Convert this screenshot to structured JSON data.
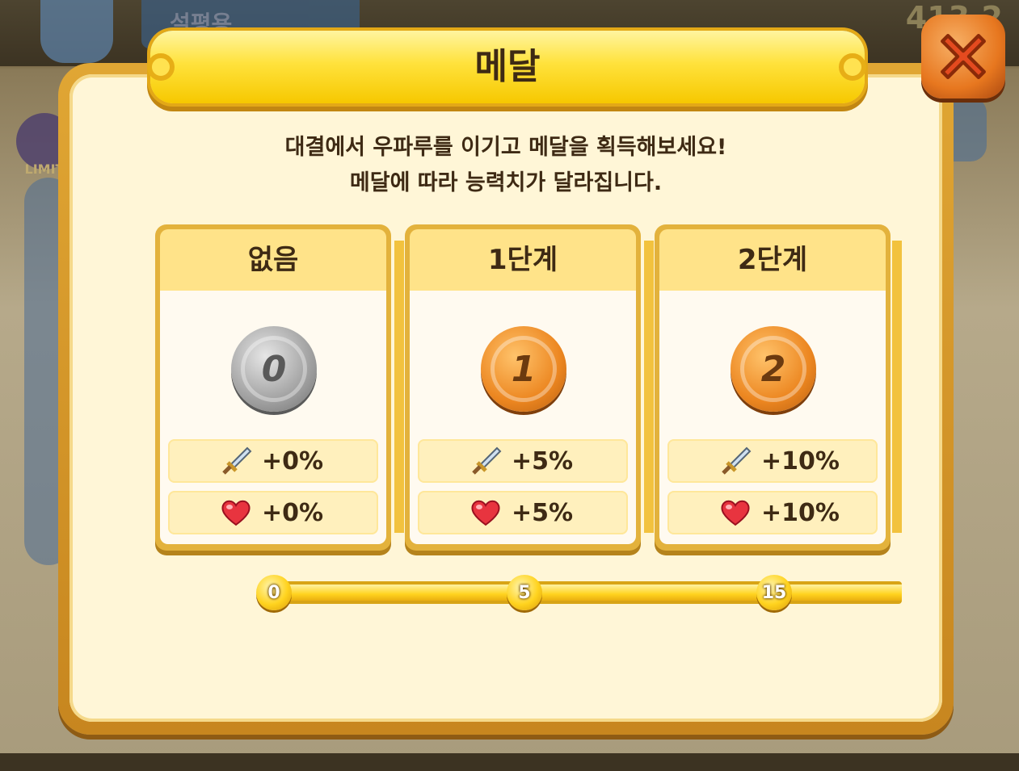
{
  "title": "메달",
  "description": [
    "대결에서 우파루를 이기고 메달을 획득해보세요!",
    "메달에 따라 능력치가 달라집니다."
  ],
  "background": {
    "top_label": "설평용",
    "coins": "413,2",
    "limit_label": "LIMIT"
  },
  "levels": [
    {
      "name": "없음",
      "medal": "0",
      "medal_type": "silver",
      "attack": "+0%",
      "health": "+0%"
    },
    {
      "name": "1단계",
      "medal": "1",
      "medal_type": "bronze",
      "attack": "+5%",
      "health": "+5%"
    },
    {
      "name": "2단계",
      "medal": "2",
      "medal_type": "bronze",
      "attack": "+10%",
      "health": "+10%"
    }
  ],
  "milestones": [
    "0",
    "5",
    "15"
  ],
  "icons": {
    "attack": "sword-icon",
    "health": "heart-icon",
    "close": "close-x-icon"
  },
  "colors": {
    "gold": "#ffd31e",
    "frame": "#d9982a",
    "bronze": "#ec8620",
    "silver": "#9b9b9b",
    "close": "#e7771f"
  }
}
